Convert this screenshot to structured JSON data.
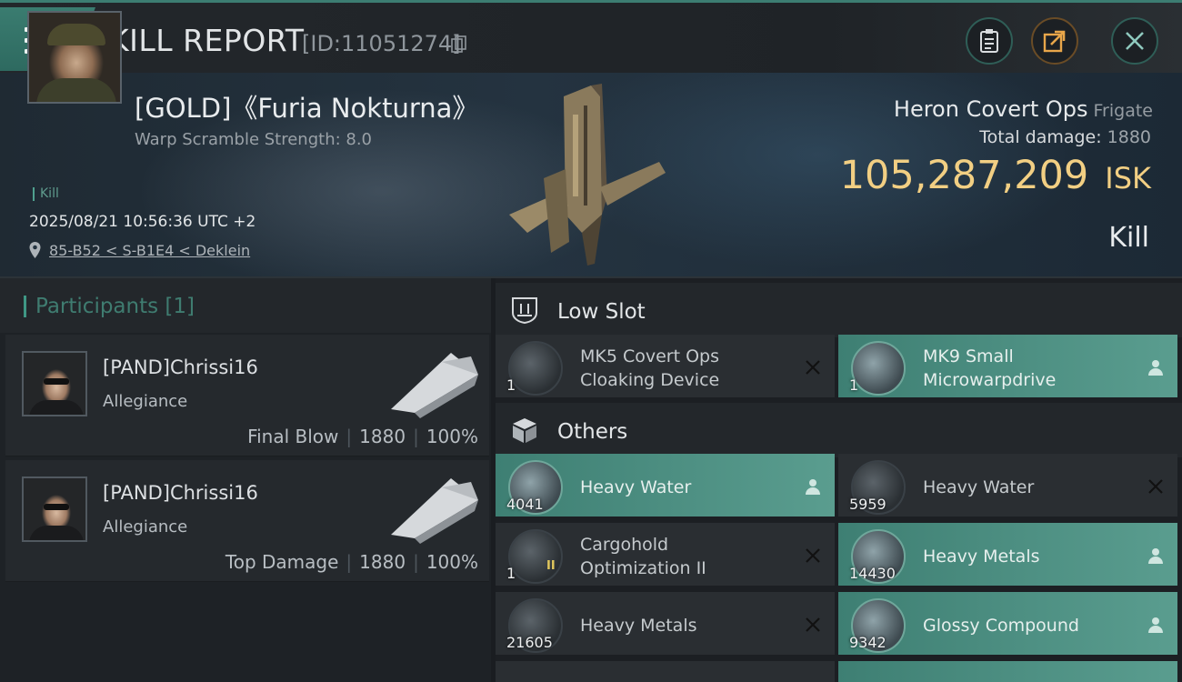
{
  "header": {
    "title": "KILL REPORT",
    "report_id": "[ID:11051274]"
  },
  "victim": {
    "name": "[GOLD]《Furia Nokturna》",
    "warp_scramble": "Warp Scramble Strength: 8.0",
    "tag": "Kill",
    "datetime": "2025/08/21 10:56:36 UTC +2",
    "location": "85-B52 < S-B1E4 < Deklein",
    "ship_name": "Heron Covert Ops",
    "ship_class": "Frigate",
    "total_damage_label": "Total damage:",
    "total_damage": "1880",
    "isk_value": "105,287,209",
    "isk_unit": "ISK",
    "result": "Kill"
  },
  "participants": {
    "title": "Participants [1]",
    "rows": [
      {
        "name": "[PAND]Chrissi16",
        "alliance": "Allegiance",
        "role": "Final Blow",
        "damage": "1880",
        "percent": "100%"
      },
      {
        "name": "[PAND]Chrissi16",
        "alliance": "Allegiance",
        "role": "Top Damage",
        "damage": "1880",
        "percent": "100%"
      }
    ]
  },
  "sections": {
    "low_slot": "Low Slot",
    "others": "Others"
  },
  "items": {
    "low_slot": [
      {
        "line1": "MK5 Covert Ops",
        "line2": "Cloaking Device",
        "qty": "1",
        "status": "destroyed"
      },
      {
        "line1": "MK9 Small",
        "line2": "Microwarpdrive",
        "qty": "1",
        "status": "dropped"
      }
    ],
    "others": [
      {
        "line1": "Heavy Water",
        "qty": "4041",
        "status": "dropped"
      },
      {
        "line1": "Heavy Water",
        "qty": "5959",
        "status": "destroyed"
      },
      {
        "line1": "Cargohold",
        "line2": "Optimization II",
        "qty": "1",
        "tier": "II",
        "status": "destroyed"
      },
      {
        "line1": "Heavy Metals",
        "qty": "14430",
        "status": "dropped"
      },
      {
        "line1": "Heavy Metals",
        "qty": "21605",
        "status": "destroyed"
      },
      {
        "line1": "Glossy Compound",
        "qty": "9342",
        "status": "dropped"
      }
    ]
  },
  "colors": {
    "accent": "#3f9785",
    "isk": "#f2cf83",
    "dropped_bg": "#4a8e81"
  }
}
